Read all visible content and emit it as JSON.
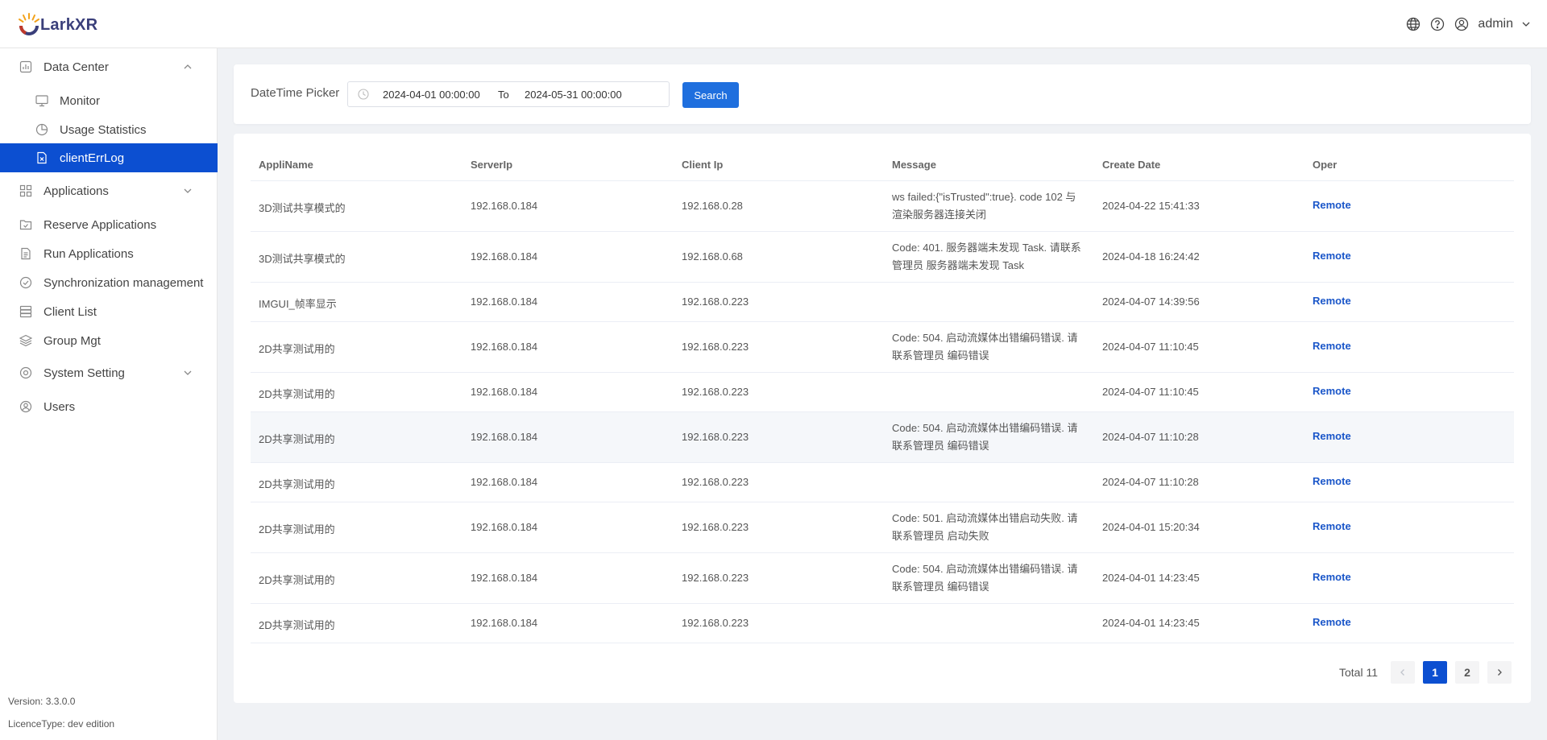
{
  "app": {
    "logo_text": "LarkXR"
  },
  "header": {
    "user_name": "admin",
    "icons": [
      "globe-icon",
      "help-icon",
      "user-icon",
      "chevron-down-icon"
    ]
  },
  "sidebar": {
    "items": [
      {
        "label": "Data Center",
        "icon": "chart-icon",
        "expanded": true
      },
      {
        "label": "Monitor",
        "icon": "monitor-icon"
      },
      {
        "label": "Usage Statistics",
        "icon": "pie-icon"
      },
      {
        "label": "clientErrLog",
        "icon": "file-x-icon",
        "active": true
      },
      {
        "label": "Applications",
        "icon": "grid-icon"
      },
      {
        "label": "Reserve Applications",
        "icon": "folder-icon"
      },
      {
        "label": "Run Applications",
        "icon": "doc-icon"
      },
      {
        "label": "Synchronization management",
        "icon": "check-circle-icon"
      },
      {
        "label": "Client List",
        "icon": "server-icon"
      },
      {
        "label": "Group Mgt",
        "icon": "layers-icon"
      },
      {
        "label": "System Setting",
        "icon": "settings-icon"
      },
      {
        "label": "Users",
        "icon": "user-icon"
      }
    ],
    "version": "Version: 3.3.0.0",
    "licence": "LicenceType: dev edition"
  },
  "filter": {
    "label": "DateTime Picker",
    "start": "2024-04-01 00:00:00",
    "to": "To",
    "end": "2024-05-31 00:00:00",
    "search_label": "Search"
  },
  "table": {
    "columns": [
      "AppliName",
      "ServerIp",
      "Client Ip",
      "Message",
      "Create Date",
      "Oper"
    ],
    "rows": [
      {
        "app": "3D测试共享模式的",
        "server": "192.168.0.184",
        "client": "192.168.0.28",
        "message": "ws failed:{\"isTrusted\":true}. code 102 与渲染服务器连接关闭",
        "date": "2024-04-22 15:41:33",
        "oper": "Remote"
      },
      {
        "app": "3D测试共享模式的",
        "server": "192.168.0.184",
        "client": "192.168.0.68",
        "message": "Code: 401. 服务器端未发现 Task. 请联系管理员 服务器端未发现 Task",
        "date": "2024-04-18 16:24:42",
        "oper": "Remote"
      },
      {
        "app": "IMGUI_帧率显示",
        "server": "192.168.0.184",
        "client": "192.168.0.223",
        "message": "",
        "date": "2024-04-07 14:39:56",
        "oper": "Remote"
      },
      {
        "app": "2D共享测试用的",
        "server": "192.168.0.184",
        "client": "192.168.0.223",
        "message": "Code: 504. 启动流媒体出错编码错误. 请联系管理员 编码错误",
        "date": "2024-04-07 11:10:45",
        "oper": "Remote"
      },
      {
        "app": "2D共享测试用的",
        "server": "192.168.0.184",
        "client": "192.168.0.223",
        "message": "",
        "date": "2024-04-07 11:10:45",
        "oper": "Remote"
      },
      {
        "app": "2D共享测试用的",
        "server": "192.168.0.184",
        "client": "192.168.0.223",
        "message": "Code: 504. 启动流媒体出错编码错误. 请联系管理员 编码错误",
        "date": "2024-04-07 11:10:28",
        "oper": "Remote"
      },
      {
        "app": "2D共享测试用的",
        "server": "192.168.0.184",
        "client": "192.168.0.223",
        "message": "",
        "date": "2024-04-07 11:10:28",
        "oper": "Remote"
      },
      {
        "app": "2D共享测试用的",
        "server": "192.168.0.184",
        "client": "192.168.0.223",
        "message": "Code: 501. 启动流媒体出错启动失败. 请联系管理员 启动失败",
        "date": "2024-04-01 15:20:34",
        "oper": "Remote"
      },
      {
        "app": "2D共享测试用的",
        "server": "192.168.0.184",
        "client": "192.168.0.223",
        "message": "Code: 504. 启动流媒体出错编码错误. 请联系管理员 编码错误",
        "date": "2024-04-01 14:23:45",
        "oper": "Remote"
      },
      {
        "app": "2D共享测试用的",
        "server": "192.168.0.184",
        "client": "192.168.0.223",
        "message": "",
        "date": "2024-04-01 14:23:45",
        "oper": "Remote"
      }
    ]
  },
  "pagination": {
    "total": "Total 11",
    "pages": [
      "1",
      "2"
    ],
    "current": "1"
  },
  "colors": {
    "primary": "#0c4fd1",
    "button": "#1f6fde",
    "link": "#1a56c9"
  }
}
